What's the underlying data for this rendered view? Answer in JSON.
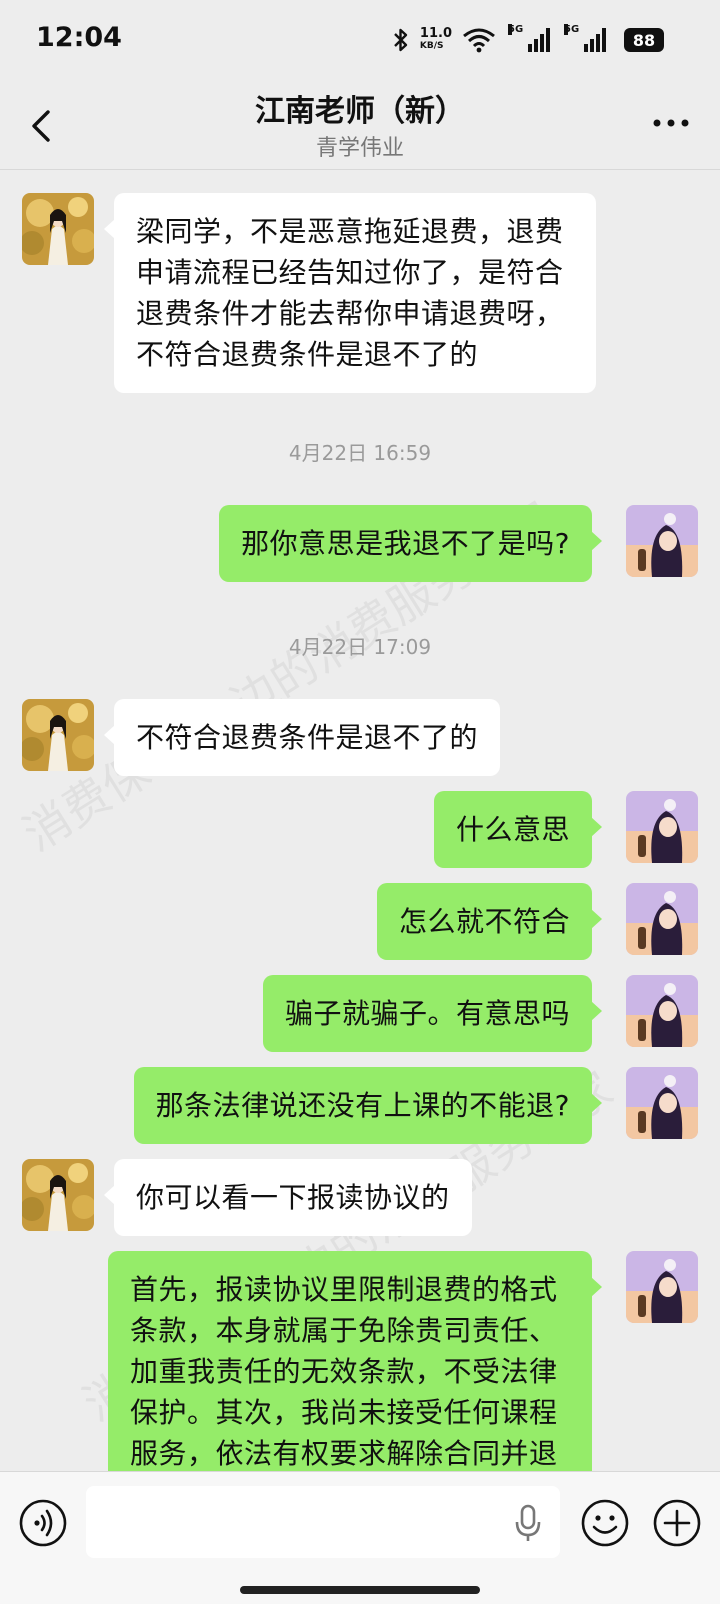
{
  "status_bar": {
    "time": "12:04",
    "net_speed_value": "11.0",
    "net_speed_unit": "KB/S",
    "signal1_label": "5G",
    "signal2_label": "5G",
    "battery": "88",
    "icons": [
      "bluetooth-icon",
      "wifi-icon",
      "signal-icon",
      "signal-icon",
      "battery-icon"
    ]
  },
  "header": {
    "title": "江南老师（新）",
    "subtitle": "青学伟业"
  },
  "messages": [
    {
      "side": "left",
      "text": "梁同学，不是恶意拖延退费，退费申请流程已经告知过你了，是符合退费条件才能去帮你申请退费呀，不符合退费条件是退不了的"
    },
    {
      "type": "time",
      "text": "4月22日 16:59"
    },
    {
      "side": "right",
      "text": "那你意思是我退不了是吗?"
    },
    {
      "type": "time",
      "text": "4月22日 17:09"
    },
    {
      "side": "left",
      "text": "不符合退费条件是退不了的"
    },
    {
      "side": "right",
      "text": "什么意思"
    },
    {
      "side": "right",
      "text": "怎么就不符合"
    },
    {
      "side": "right",
      "text": "骗子就骗子。有意思吗"
    },
    {
      "side": "right",
      "text": "那条法律说还没有上课的不能退?"
    },
    {
      "side": "left",
      "text": "你可以看一下报读协议的"
    },
    {
      "side": "right",
      "text": "首先，报读协议里限制退费的格式条款，本身就属于免除贵司责任、加重我责任的无效条款，不受法律保护。其次，我尚未接受任何课程服务，依法有权要求解除合同并退"
    }
  ],
  "watermark": {
    "text1": "消费保 您身边的消费服务管家",
    "text2": "消费保 您身边的消费服务管家"
  },
  "colors": {
    "background": "#ededed",
    "bubble_self": "#95ec69",
    "bubble_other": "#ffffff",
    "timestamp": "#9a9a9a"
  }
}
